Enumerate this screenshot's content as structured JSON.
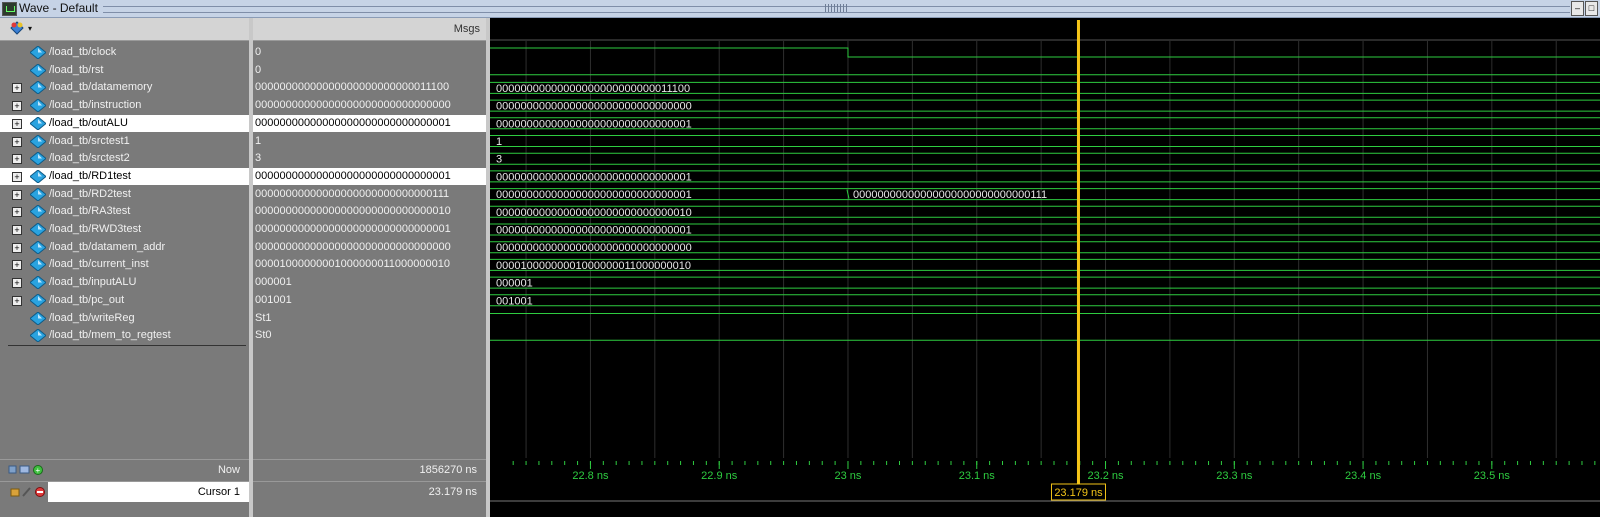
{
  "window": {
    "title": "Wave - Default",
    "btn_min": "–",
    "btn_max": "□"
  },
  "header": {
    "msgs_label": "Msgs",
    "dropdown": "▾"
  },
  "signals": [
    {
      "name": "/load_tb/clock",
      "value": "0",
      "expandable": false,
      "selected": false,
      "wave": "0",
      "change": null
    },
    {
      "name": "/load_tb/rst",
      "value": "0",
      "expandable": false,
      "selected": false,
      "wave": "",
      "change": null
    },
    {
      "name": "/load_tb/datamemory",
      "value": "00000000000000000000000000011100",
      "expandable": true,
      "selected": false,
      "wave": "00000000000000000000000000011100",
      "change": null
    },
    {
      "name": "/load_tb/instruction",
      "value": "00000000000000000000000000000000",
      "expandable": true,
      "selected": false,
      "wave": "00000000000000000000000000000000",
      "change": null
    },
    {
      "name": "/load_tb/outALU",
      "value": "00000000000000000000000000000001",
      "expandable": true,
      "selected": true,
      "wave": "00000000000000000000000000000001",
      "change": null
    },
    {
      "name": "/load_tb/srctest1",
      "value": "1",
      "expandable": true,
      "selected": false,
      "wave": "1",
      "change": null
    },
    {
      "name": "/load_tb/srctest2",
      "value": "3",
      "expandable": true,
      "selected": false,
      "wave": "3",
      "change": null
    },
    {
      "name": "/load_tb/RD1test",
      "value": "00000000000000000000000000000001",
      "expandable": true,
      "selected": true,
      "wave": "00000000000000000000000000000001",
      "change": null
    },
    {
      "name": "/load_tb/RD2test",
      "value": "00000000000000000000000000000111",
      "expandable": true,
      "selected": false,
      "wave": "00000000000000000000000000000001",
      "change": "00000000000000000000000000000111"
    },
    {
      "name": "/load_tb/RA3test",
      "value": "00000000000000000000000000000010",
      "expandable": true,
      "selected": false,
      "wave": "00000000000000000000000000000010",
      "change": null
    },
    {
      "name": "/load_tb/RWD3test",
      "value": "00000000000000000000000000000001",
      "expandable": true,
      "selected": false,
      "wave": "00000000000000000000000000000001",
      "change": null
    },
    {
      "name": "/load_tb/datamem_addr",
      "value": "00000000000000000000000000000000",
      "expandable": true,
      "selected": false,
      "wave": "00000000000000000000000000000000",
      "change": null
    },
    {
      "name": "/load_tb/current_inst",
      "value": "00001000000001000000011000000010",
      "expandable": true,
      "selected": false,
      "wave": "00001000000001000000011000000010",
      "change": null
    },
    {
      "name": "/load_tb/inputALU",
      "value": "000001",
      "expandable": true,
      "selected": false,
      "wave": "000001",
      "change": null
    },
    {
      "name": "/load_tb/pc_out",
      "value": "001001",
      "expandable": true,
      "selected": false,
      "wave": "001001",
      "change": null
    },
    {
      "name": "/load_tb/writeReg",
      "value": "St1",
      "expandable": false,
      "selected": false,
      "wave": "",
      "change": null
    },
    {
      "name": "/load_tb/mem_to_regtest",
      "value": "St0",
      "expandable": false,
      "selected": false,
      "wave": "",
      "change": null
    }
  ],
  "status": {
    "now_label": "Now",
    "now_value": "1856270 ns",
    "cursor_label": "Cursor 1",
    "cursor_value": "23.179 ns"
  },
  "timeline": {
    "ticks": [
      "22.8 ns",
      "22.9 ns",
      "23 ns",
      "23.1 ns",
      "23.2 ns",
      "23.3 ns",
      "23.4 ns",
      "23.5 ns"
    ],
    "tick_values": [
      22.8,
      22.9,
      23.0,
      23.1,
      23.2,
      23.3,
      23.4,
      23.5
    ],
    "view_start": 22.722,
    "view_end": 23.584,
    "clock_fall": 23.0,
    "rd2_change": 23.0,
    "cursor_time": 23.179,
    "cursor_label": "23.179 ns"
  },
  "colors": {
    "wave": "#2ecc40",
    "cursor": "#f5c518",
    "grid": "#2e2e2e",
    "bg": "#000000",
    "text": "#e8e8e8"
  }
}
